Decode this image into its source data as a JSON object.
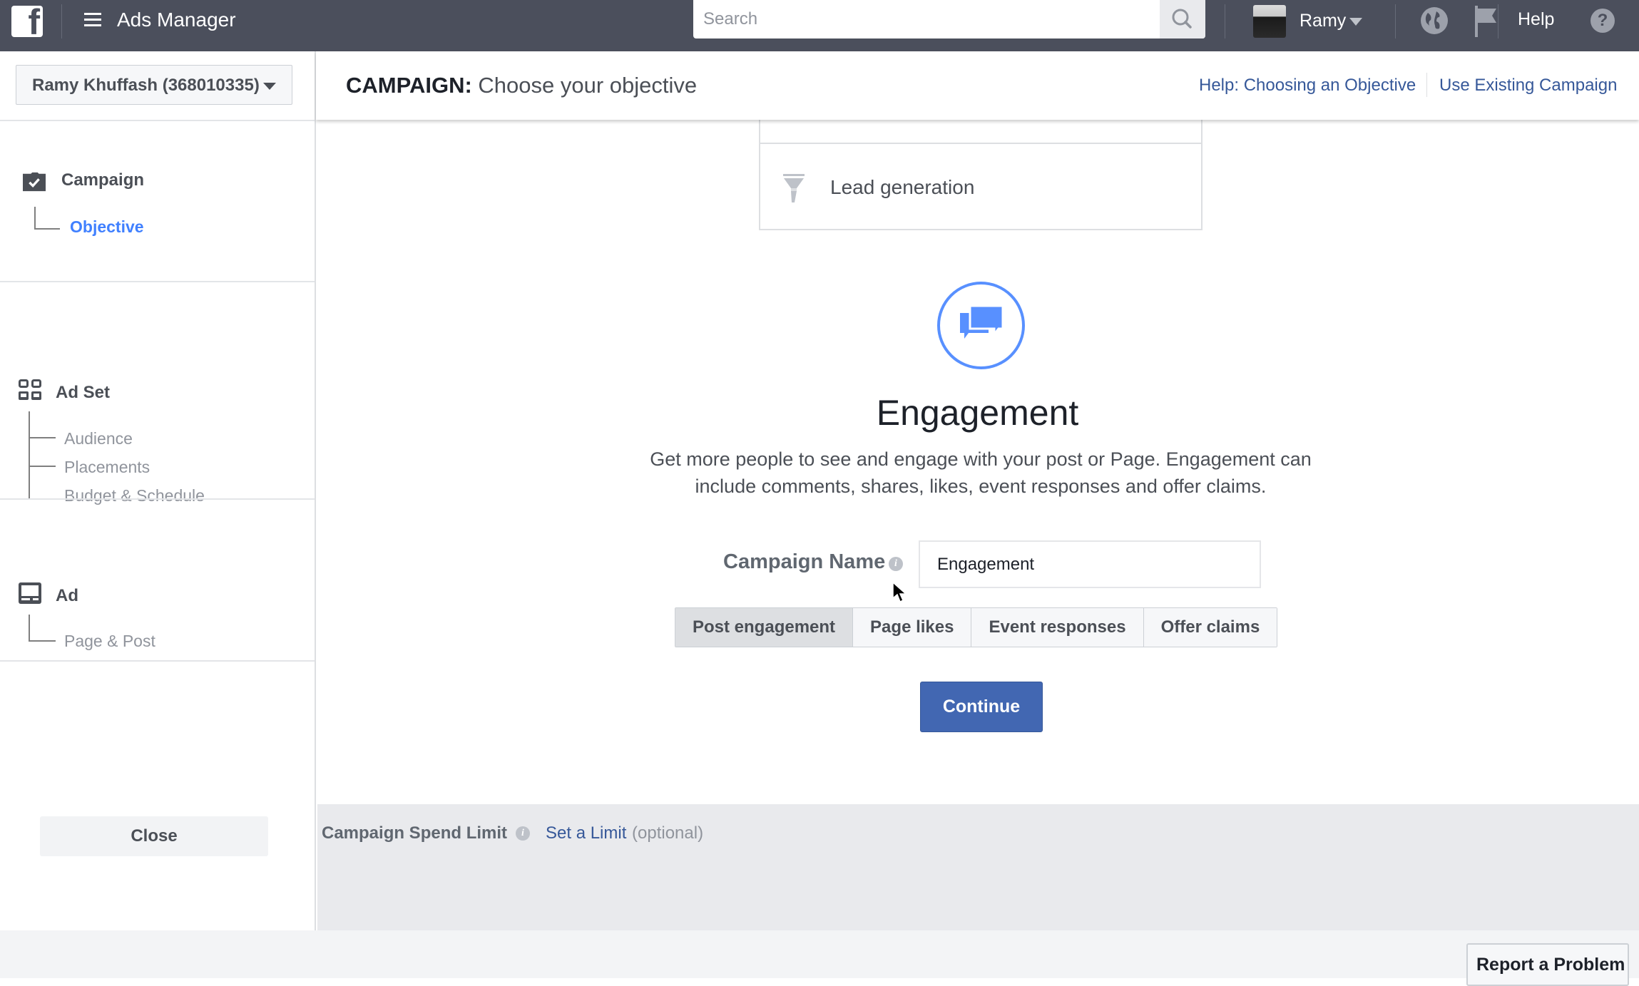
{
  "topbar": {
    "app_title": "Ads Manager",
    "search_placeholder": "Search",
    "user_name": "Ramy",
    "help_label": "Help",
    "help_glyph": "?",
    "icons": [
      "facebook-logo",
      "menu-icon",
      "search-icon",
      "avatar",
      "caret-down-icon",
      "globe-icon",
      "flag-icon",
      "help-icon"
    ]
  },
  "sidebar": {
    "account": "Ramy Khuffash (368010335)",
    "sections": [
      {
        "title": "Campaign",
        "icon": "campaign-check-icon",
        "items": [
          {
            "label": "Objective",
            "active": true
          }
        ]
      },
      {
        "title": "Ad Set",
        "icon": "grid-icon",
        "items": [
          {
            "label": "Audience"
          },
          {
            "label": "Placements"
          },
          {
            "label": "Budget & Schedule"
          }
        ]
      },
      {
        "title": "Ad",
        "icon": "ad-icon",
        "items": [
          {
            "label": "Page & Post"
          }
        ]
      }
    ],
    "close_label": "Close"
  },
  "header": {
    "title_prefix": "CAMPAIGN:",
    "title": "Choose your objective",
    "links": [
      "Help: Choosing an Objective",
      "Use Existing Campaign"
    ]
  },
  "objective_list": {
    "visible_item": "Lead generation",
    "icon": "funnel-icon"
  },
  "selected_objective": {
    "icon": "chat-bubbles-icon",
    "title": "Engagement",
    "description": "Get more people to see and engage with your post or Page. Engagement can include comments, shares, likes, event responses and offer claims.",
    "campaign_name_label": "Campaign Name",
    "campaign_name_value": "Engagement",
    "options": [
      "Post engagement",
      "Page likes",
      "Event responses",
      "Offer claims"
    ],
    "selected_option": "Post engagement",
    "continue_label": "Continue"
  },
  "spend_limit": {
    "label": "Campaign Spend Limit",
    "link": "Set a Limit",
    "optional": "(optional)"
  },
  "footer": {
    "report_label": "Report a Problem"
  },
  "colors": {
    "topbar": "#4b4f5c",
    "primary": "#4267b2",
    "link": "#365899",
    "active_nav": "#4080ff",
    "engagement_icon": "#5890ff"
  }
}
